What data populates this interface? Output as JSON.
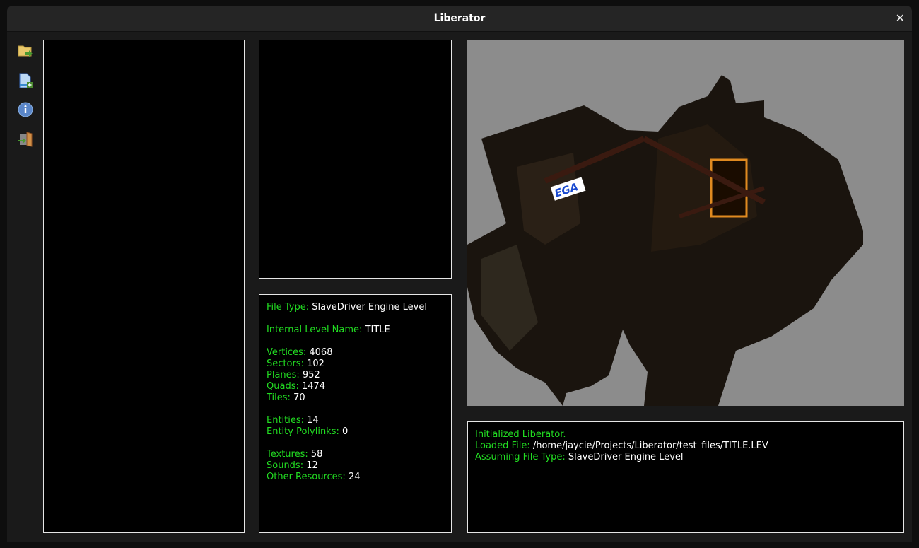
{
  "window": {
    "title": "Liberator",
    "close_icon": "close-icon"
  },
  "toolbar": [
    {
      "name": "open-file",
      "icon": "folder-open-icon"
    },
    {
      "name": "new-file",
      "icon": "new-document-icon"
    },
    {
      "name": "about",
      "icon": "info-icon"
    },
    {
      "name": "exit",
      "icon": "exit-door-icon"
    }
  ],
  "info": {
    "file_type": {
      "label": "File Type:",
      "value": "SlaveDriver Engine Level"
    },
    "level_name": {
      "label": "Internal Level Name:",
      "value": "TITLE"
    },
    "vertices": {
      "label": "Vertices:",
      "value": "4068"
    },
    "sectors": {
      "label": "Sectors:",
      "value": "102"
    },
    "planes": {
      "label": "Planes:",
      "value": "952"
    },
    "quads": {
      "label": "Quads:",
      "value": "1474"
    },
    "tiles": {
      "label": "Tiles:",
      "value": "70"
    },
    "entities": {
      "label": "Entities:",
      "value": "14"
    },
    "polylinks": {
      "label": "Entity Polylinks:",
      "value": "0"
    },
    "textures": {
      "label": "Textures:",
      "value": "58"
    },
    "sounds": {
      "label": "Sounds:",
      "value": "12"
    },
    "other": {
      "label": "Other Resources:",
      "value": "24"
    }
  },
  "log": {
    "line1": "Initialized Liberator.",
    "line2": {
      "label": "Loaded File:",
      "value": "/home/jaycie/Projects/Liberator/test_files/TITLE.LEV"
    },
    "line3": {
      "label": "Assuming File Type:",
      "value": "SlaveDriver Engine Level"
    }
  },
  "viewport": {
    "sign_text": "EGA"
  }
}
